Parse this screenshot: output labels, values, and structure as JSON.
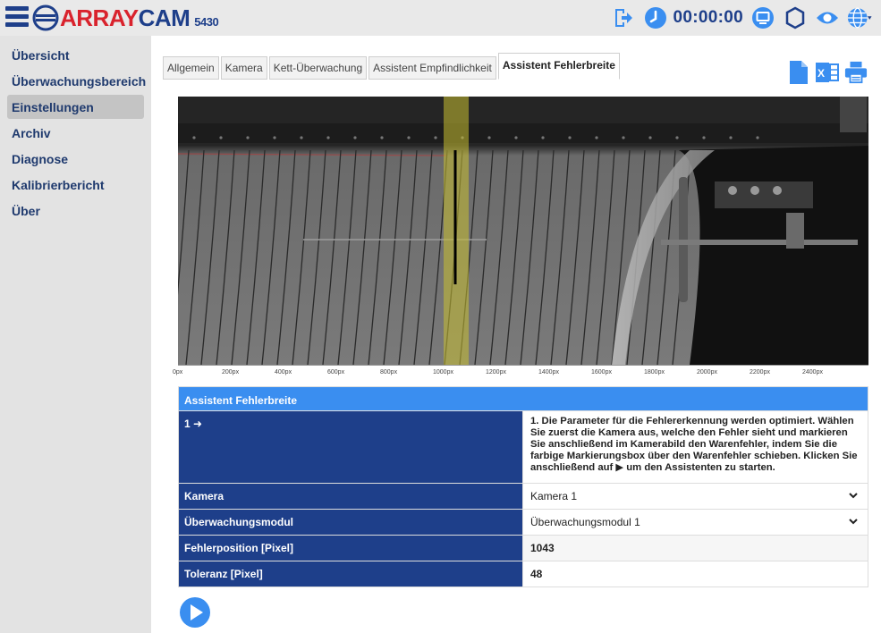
{
  "header": {
    "brand_part1": "ARRAY",
    "brand_part2": "CAM",
    "model": "5430",
    "timer": "00:00:00",
    "icons": [
      "menu-icon",
      "logo-icon",
      "logout-icon",
      "clock-icon",
      "monitor-icon",
      "gear-icon",
      "eye-icon",
      "globe-icon"
    ],
    "accent": "#1e3f8a",
    "brand_red": "#d9232d"
  },
  "sidebar": {
    "items": [
      {
        "label": "Übersicht"
      },
      {
        "label": "Überwachungsbereich"
      },
      {
        "label": "Einstellungen",
        "active": true
      },
      {
        "label": "Archiv"
      },
      {
        "label": "Diagnose"
      },
      {
        "label": "Kalibrierbericht"
      },
      {
        "label": "Über"
      }
    ]
  },
  "tabs": [
    {
      "label": "Allgemein"
    },
    {
      "label": "Kamera"
    },
    {
      "label": "Kett-Überwachung"
    },
    {
      "label": "Assistent Empfindlichkeit"
    },
    {
      "label": "Assistent Fehlerbreite",
      "active": true
    }
  ],
  "toolbar": {
    "icons": [
      "document-icon",
      "excel-icon",
      "print-icon"
    ]
  },
  "camera": {
    "scale_labels": [
      "0px",
      "200px",
      "400px",
      "600px",
      "800px",
      "1000px",
      "1200px",
      "1400px",
      "1600px",
      "1800px",
      "2000px",
      "2200px",
      "2400px"
    ],
    "marker_color": "#c8c032"
  },
  "wizard": {
    "title": "Assistent Fehlerbreite",
    "step_label": "1 ➜",
    "step_text": "1. Die Parameter für die Fehlererkennung werden optimiert. Wählen Sie zuerst die Kamera aus, welche den Fehler sieht und markieren Sie anschließend im Kamerabild den Warenfehler, indem Sie die farbige Markierungsbox über den Warenfehler schieben. Klicken Sie anschließend auf ▶ um den Assistenten zu starten.",
    "rows": {
      "kamera": {
        "label": "Kamera",
        "value": "Kamera 1"
      },
      "modul": {
        "label": "Überwachungsmodul",
        "value": "Überwachungsmodul 1"
      },
      "position": {
        "label": "Fehlerposition [Pixel]",
        "value": "1043"
      },
      "toleranz": {
        "label": "Toleranz [Pixel]",
        "value": "48"
      }
    },
    "header_color": "#3a8ef0",
    "label_bg": "#1e3f8a"
  },
  "play_button": {
    "icon": "play-icon"
  }
}
